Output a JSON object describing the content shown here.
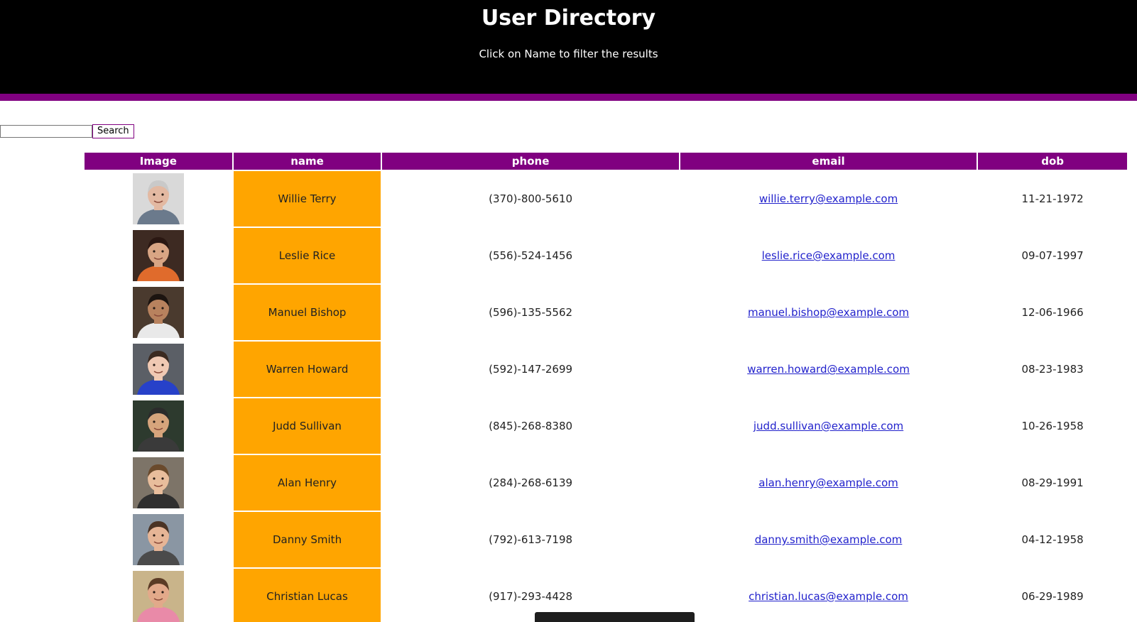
{
  "header": {
    "title": "User Directory",
    "subtitle": "Click on Name to filter the results"
  },
  "search": {
    "value": "",
    "placeholder": "",
    "button_label": "Search"
  },
  "table": {
    "columns": [
      "Image",
      "name",
      "phone",
      "email",
      "dob"
    ],
    "rows": [
      {
        "name": "Willie Terry",
        "phone": "(370)-800-5610",
        "email": "willie.terry@example.com",
        "dob": "11-21-1972",
        "avatar": {
          "bg": "#d9d9d9",
          "skin": "#e3b9a2",
          "hair": "#c9c9c9",
          "shirt": "#6b7a8c"
        }
      },
      {
        "name": "Leslie Rice",
        "phone": "(556)-524-1456",
        "email": "leslie.rice@example.com",
        "dob": "09-07-1997",
        "avatar": {
          "bg": "#3d2a22",
          "skin": "#d9a584",
          "hair": "#2a1712",
          "shirt": "#e06b2c"
        }
      },
      {
        "name": "Manuel Bishop",
        "phone": "(596)-135-5562",
        "email": "manuel.bishop@example.com",
        "dob": "12-06-1966",
        "avatar": {
          "bg": "#4a3a2e",
          "skin": "#b8825e",
          "hair": "#1c1410",
          "shirt": "#e9e9e9"
        }
      },
      {
        "name": "Warren Howard",
        "phone": "(592)-147-2699",
        "email": "warren.howard@example.com",
        "dob": "08-23-1983",
        "avatar": {
          "bg": "#5b5f66",
          "skin": "#f0c9b3",
          "hair": "#3b2a20",
          "shirt": "#2741c9"
        }
      },
      {
        "name": "Judd Sullivan",
        "phone": "(845)-268-8380",
        "email": "judd.sullivan@example.com",
        "dob": "10-26-1958",
        "avatar": {
          "bg": "#2d3a2e",
          "skin": "#d6a47c",
          "hair": "#2b2b2b",
          "shirt": "#3a3a3a"
        }
      },
      {
        "name": "Alan Henry",
        "phone": "(284)-268-6139",
        "email": "alan.henry@example.com",
        "dob": "08-29-1991",
        "avatar": {
          "bg": "#7d7468",
          "skin": "#e8bd9c",
          "hair": "#6a4a2c",
          "shirt": "#2f2f2f"
        }
      },
      {
        "name": "Danny Smith",
        "phone": "(792)-613-7198",
        "email": "danny.smith@example.com",
        "dob": "04-12-1958",
        "avatar": {
          "bg": "#8a96a3",
          "skin": "#e6b596",
          "hair": "#4a3324",
          "shirt": "#4b4b4b"
        }
      },
      {
        "name": "Christian Lucas",
        "phone": "(917)-293-4428",
        "email": "christian.lucas@example.com",
        "dob": "06-29-1989",
        "avatar": {
          "bg": "#c9b48a",
          "skin": "#e2a98a",
          "hair": "#5b3b25",
          "shirt": "#e98aa8"
        }
      }
    ]
  },
  "colors": {
    "header_bg": "#000000",
    "accent": "#800080",
    "name_cell_bg": "#FFA500",
    "link": "#2222cc"
  }
}
